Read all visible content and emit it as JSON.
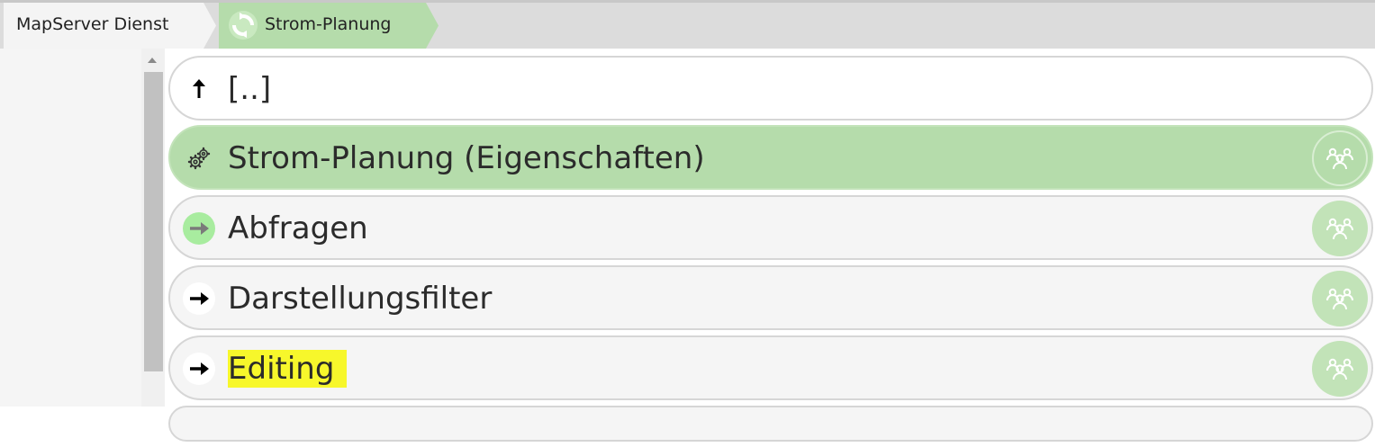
{
  "breadcrumb": {
    "root": "MapServer Dienst",
    "active": "Strom-Planung"
  },
  "list": {
    "up": "[..]",
    "items": [
      {
        "label": "Strom-Planung (Eigenschaften)",
        "icon": "gears-icon",
        "state": "selected"
      },
      {
        "label": "Abfragen",
        "icon": "arrow-right-icon",
        "state": "normal"
      },
      {
        "label": "Darstellungsfilter",
        "icon": "arrow-right-icon",
        "state": "normal"
      },
      {
        "label": "Editing",
        "icon": "arrow-right-icon",
        "state": "highlighted"
      }
    ]
  },
  "colors": {
    "accent_green": "#b5dcab",
    "highlight_yellow": "#f7f72b",
    "bar_gray": "#dcdcdc"
  }
}
